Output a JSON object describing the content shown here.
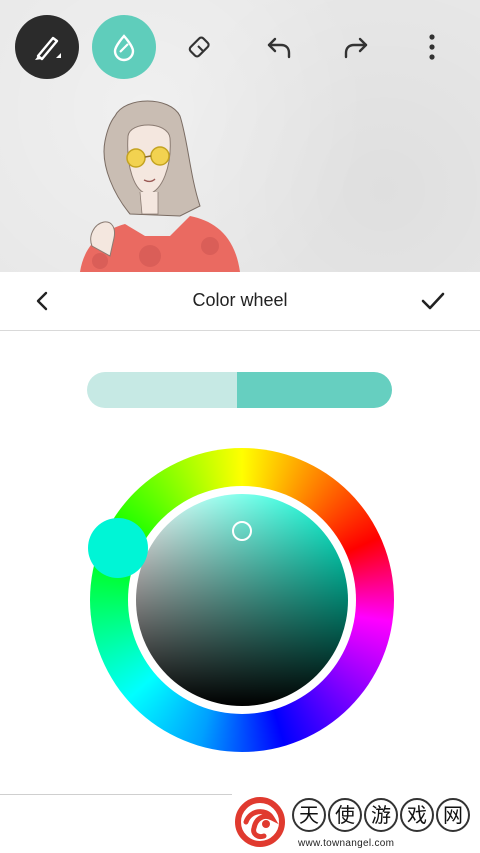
{
  "toolbar": {
    "icons": [
      "brush-icon",
      "color-drop-icon",
      "eraser-icon",
      "undo-icon",
      "redo-icon",
      "more-vertical-icon"
    ]
  },
  "header": {
    "title": "Color wheel",
    "back_icon": "chevron-left-icon",
    "confirm_icon": "check-icon"
  },
  "color_compare": {
    "previous_color": "#c6e9e4",
    "current_color": "#66cfc0"
  },
  "color_wheel": {
    "hue_handle_color": "#00f5d6",
    "selected_hue_color": "#00ffd8"
  },
  "colors": {
    "accent": "#5fcdbb",
    "toolbar_dark": "#2b2b2b"
  },
  "watermark": {
    "characters": [
      "天",
      "使",
      "游",
      "戏",
      "网"
    ],
    "url": "www.townangel.com"
  }
}
